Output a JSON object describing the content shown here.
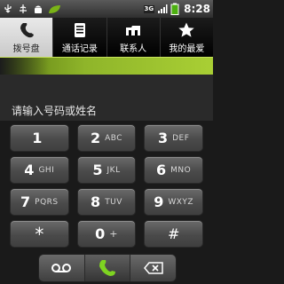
{
  "status_bar": {
    "time": "8:28",
    "network_badge": "3G",
    "icons": [
      "usb-icon",
      "usb-debug-icon",
      "android-icon",
      "leaf-icon",
      "signal-icon",
      "battery-icon"
    ]
  },
  "tabs": [
    {
      "label": "拨号盘",
      "icon": "dialpad-phone-icon",
      "active": true
    },
    {
      "label": "通话记录",
      "icon": "call-log-icon",
      "active": false
    },
    {
      "label": "联系人",
      "icon": "contacts-icon",
      "active": false
    },
    {
      "label": "我的最爱",
      "icon": "star-icon",
      "active": false
    }
  ],
  "input": {
    "placeholder": "请输入号码或姓名"
  },
  "keypad": [
    {
      "digit": "1",
      "letters": ""
    },
    {
      "digit": "2",
      "letters": "ABC"
    },
    {
      "digit": "3",
      "letters": "DEF"
    },
    {
      "digit": "4",
      "letters": "GHI"
    },
    {
      "digit": "5",
      "letters": "JKL"
    },
    {
      "digit": "6",
      "letters": "MNO"
    },
    {
      "digit": "7",
      "letters": "PQRS"
    },
    {
      "digit": "8",
      "letters": "TUV"
    },
    {
      "digit": "9",
      "letters": "WXYZ"
    },
    {
      "digit": "*",
      "letters": ""
    },
    {
      "digit": "0",
      "letters": "+"
    },
    {
      "digit": "#",
      "letters": ""
    }
  ],
  "bottom_bar": {
    "buttons": [
      "voicemail-icon",
      "call-icon",
      "backspace-icon"
    ]
  },
  "colors": {
    "accent_green": "#8fb52a",
    "call_green": "#7ed321"
  }
}
